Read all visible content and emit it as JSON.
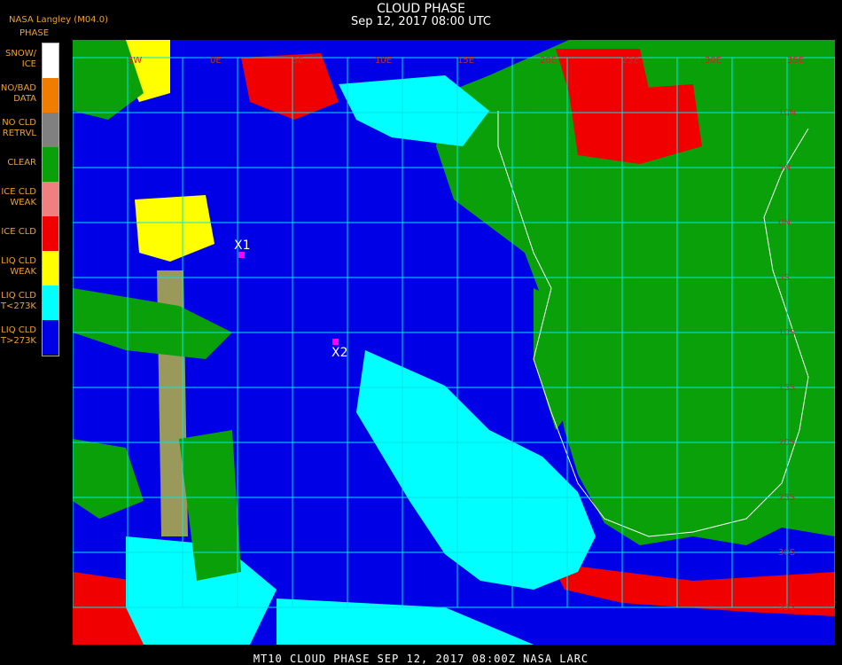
{
  "header": {
    "title": "CLOUD PHASE",
    "subtitle": "Sep 12, 2017 08:00 UTC",
    "version": "NASA Langley (M04.0)",
    "legend_title": "PHASE"
  },
  "legend": [
    {
      "label": "SNOW/\nICE",
      "color": "#ffffff"
    },
    {
      "label": "NO/BAD\nDATA",
      "color": "#f07d00"
    },
    {
      "label": "NO CLD\nRETRVL",
      "color": "#808080"
    },
    {
      "label": "CLEAR",
      "color": "#0aa00a"
    },
    {
      "label": "ICE CLD\nWEAK",
      "color": "#f08080"
    },
    {
      "label": "ICE CLD",
      "color": "#f00000"
    },
    {
      "label": "LIQ CLD\nWEAK",
      "color": "#ffff00"
    },
    {
      "label": "LIQ CLD\nT<273K",
      "color": "#00ffff"
    },
    {
      "label": "LIQ CLD\nT>273K",
      "color": "#0000e6"
    }
  ],
  "markers": [
    {
      "label": "X1",
      "color": "#ff00ff"
    },
    {
      "label": "X2",
      "color": "#ff00ff"
    }
  ],
  "grid_labels": {
    "top": [
      "5W",
      "0E",
      "5E",
      "10E",
      "15E",
      "20E",
      "25E",
      "30E",
      "35E"
    ],
    "right": [
      "10N",
      "5N",
      "0N",
      "5S",
      "10S",
      "15S",
      "20S",
      "25S",
      "30S",
      "35S"
    ]
  },
  "footer": "MT10   CLOUD PHASE   SEP 12, 2017 08:00Z   NASA LARC"
}
